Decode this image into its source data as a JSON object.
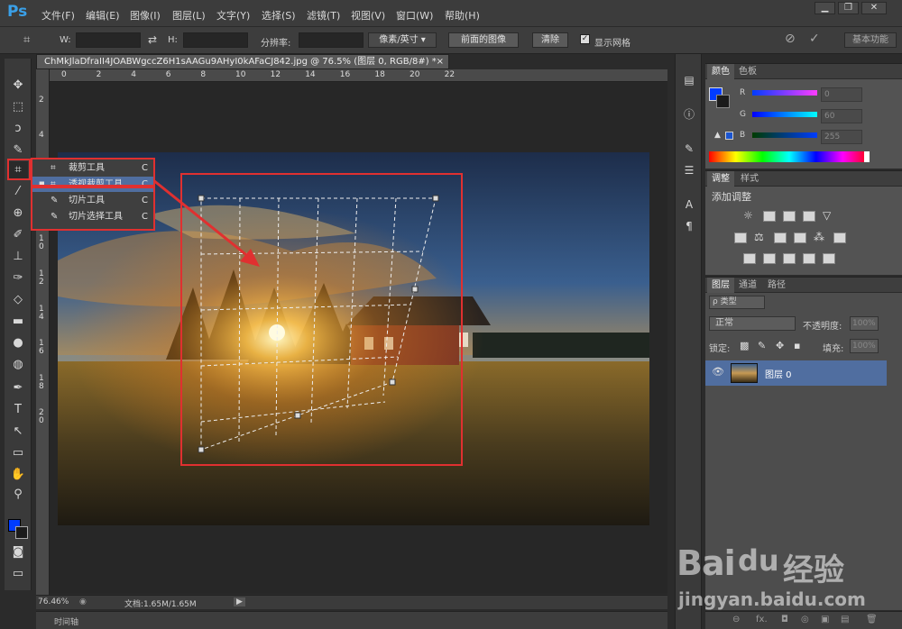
{
  "app": {
    "logo": "Ps"
  },
  "menu": [
    "文件(F)",
    "编辑(E)",
    "图像(I)",
    "图层(L)",
    "文字(Y)",
    "选择(S)",
    "滤镜(T)",
    "视图(V)",
    "窗口(W)",
    "帮助(H)"
  ],
  "window_controls": {
    "minimize": "▁",
    "restore": "❐",
    "close": "✕"
  },
  "options": {
    "w_label": "W:",
    "h_label": "H:",
    "swap_icon": "⇄",
    "resolution_label": "分辨率:",
    "unit_select": "像素/英寸",
    "front_image_button": "前面的图像",
    "clear_button": "清除",
    "show_grid_label": "显示网格",
    "show_grid_checked": true,
    "cancel_icon": "⊘",
    "commit_icon": "✓",
    "workspace_button": "基本功能"
  },
  "document": {
    "tab_title": "ChMkJlaDfraII4JOABWgccZ6H1sAAGu9AHyI0kAFaCJ842.jpg @ 76.5% (图层 0, RGB/8#) *",
    "tab_close": "×",
    "ruler_h": [
      "0",
      "2",
      "4",
      "6",
      "8",
      "10",
      "12",
      "14",
      "16",
      "18",
      "20",
      "22"
    ],
    "ruler_v": [
      "2",
      "4",
      "6",
      "8",
      "1\n0",
      "1\n2",
      "1\n4",
      "1\n6",
      "1\n8",
      "2\n0"
    ]
  },
  "status": {
    "zoom": "76.46%",
    "doc_info": "文档:1.65M/1.65M",
    "arrow": "▶"
  },
  "timeline": {
    "label": "时间轴"
  },
  "tool_flyout": {
    "items": [
      {
        "icon": "crop-icon",
        "label": "裁剪工具",
        "shortcut": "C",
        "selected": false
      },
      {
        "icon": "perspective-crop-icon",
        "label": "透视裁剪工具",
        "shortcut": "C",
        "selected": true
      },
      {
        "icon": "slice-icon",
        "label": "切片工具",
        "shortcut": "C",
        "selected": false
      },
      {
        "icon": "slice-select-icon",
        "label": "切片选择工具",
        "shortcut": "C",
        "selected": false
      }
    ],
    "selected_marker": "■"
  },
  "color_panel": {
    "tabs": [
      "颜色",
      "色板"
    ],
    "channels": [
      {
        "label": "R",
        "value": "0"
      },
      {
        "label": "G",
        "value": "60"
      },
      {
        "label": "B",
        "value": "255"
      }
    ],
    "foreground": "#003cff",
    "warning_icon": "▲"
  },
  "adjust_panel": {
    "tabs": [
      "调整",
      "样式"
    ],
    "title": "添加调整"
  },
  "layers_panel": {
    "tabs": [
      "图层",
      "通道",
      "路径"
    ],
    "kind_label": "ρ 类型",
    "blend_mode": "正常",
    "opacity_label": "不透明度:",
    "opacity_value": "100%",
    "lock_label": "锁定:",
    "fill_label": "填充:",
    "fill_value": "100%",
    "layers": [
      {
        "name": "图层 0",
        "visible": true
      }
    ]
  },
  "bottom_icons": [
    "⊖",
    "fx.",
    "◘",
    "◎",
    "▣",
    "▤",
    "🗑"
  ],
  "watermark": {
    "brand_prefix": "Bai",
    "brand_suffix": "经验",
    "url": "jingyan.baidu.com",
    "paw_glyph": "du"
  },
  "colors": {
    "highlight_red": "#e03030",
    "selection_blue": "#506ea0",
    "accent_blue": "#1b55d0"
  }
}
